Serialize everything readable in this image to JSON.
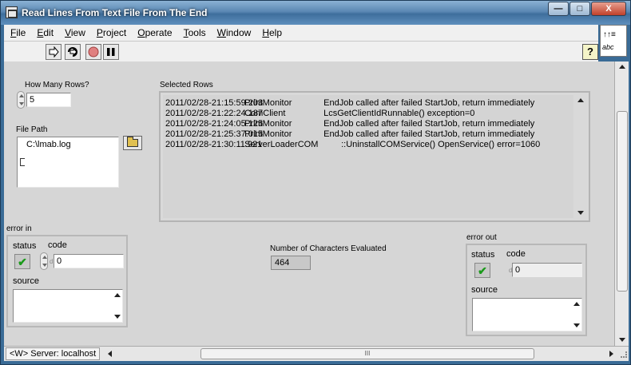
{
  "window": {
    "title": "Read Lines From Text File From The End",
    "minimize_glyph": "—",
    "maximize_glyph": "□",
    "close_glyph": "X"
  },
  "menu": {
    "items": [
      {
        "key": "F",
        "rest": "ile"
      },
      {
        "key": "E",
        "rest": "dit"
      },
      {
        "key": "V",
        "rest": "iew"
      },
      {
        "key": "P",
        "rest": "roject"
      },
      {
        "key": "O",
        "rest": "perate"
      },
      {
        "key": "T",
        "rest": "ools"
      },
      {
        "key": "W",
        "rest": "indow"
      },
      {
        "key": "H",
        "rest": "elp"
      }
    ]
  },
  "toolbar": {
    "help_label": "?",
    "icons": [
      "run-arrow-icon",
      "run-continuously-icon",
      "abort-icon",
      "pause-icon"
    ]
  },
  "vi_icon": {
    "top": "↑↑≡",
    "bottom": "abc"
  },
  "rows_control": {
    "label": "How Many Rows?",
    "value": "5"
  },
  "file_path": {
    "label": "File Path",
    "value": "C:\\lmab.log"
  },
  "selected_rows": {
    "label": "Selected Rows",
    "rows": [
      {
        "time": "2011/02/28-21:15:59.203",
        "source": "PrintMonitor",
        "message": "EndJob called after failed StartJob, return immediately"
      },
      {
        "time": "2011/02/28-21:22:24.187",
        "source": "ComClient",
        "message": "LcsGetClientIdRunnable() exception=0"
      },
      {
        "time": "2011/02/28-21:24:05.125",
        "source": "PrintMonitor",
        "message": "EndJob called after failed StartJob, return immediately"
      },
      {
        "time": "2011/02/28-21:25:37.015",
        "source": "PrintMonitor",
        "message": "EndJob called after failed StartJob, return immediately"
      },
      {
        "time": "2011/02/28-21:30:11.921",
        "source": "ServerLoaderCOM",
        "message": "::UninstallCOMService() OpenService() error=1060"
      }
    ]
  },
  "error_in": {
    "label": "error in",
    "status_label": "status",
    "code_label": "code",
    "code_value": "0",
    "code_prefix": "d",
    "source_label": "source",
    "source_value": ""
  },
  "num_chars": {
    "label": "Number of Characters Evaluated",
    "value": "464"
  },
  "error_out": {
    "label": "error out",
    "status_label": "status",
    "code_label": "code",
    "code_value": "0",
    "code_prefix": "d",
    "source_label": "source",
    "source_value": ""
  },
  "statusbar": {
    "server": "<W> Server: localhost",
    "grip": "III"
  },
  "colors": {
    "panel_bg": "#d6d6d6",
    "status_ok": "#1a9a1a",
    "title_bg": "#5b88b3"
  }
}
